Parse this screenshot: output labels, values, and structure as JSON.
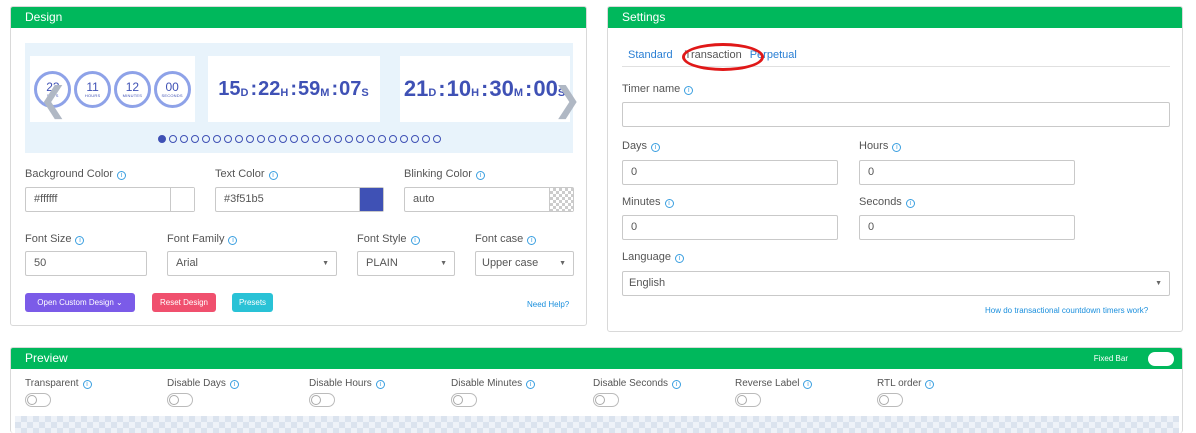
{
  "design": {
    "title": "Design",
    "circles": [
      {
        "value": "23",
        "label": "DAYS"
      },
      {
        "value": "11",
        "label": "HOURS"
      },
      {
        "value": "12",
        "label": "MINUTES"
      },
      {
        "value": "00",
        "label": "SECONDS"
      }
    ],
    "slide2": {
      "d": "15",
      "h": "22",
      "m": "59",
      "s": "07",
      "ud": "D",
      "uh": "H",
      "um": "M",
      "us": "S"
    },
    "slide3": {
      "d": "21",
      "h": "10",
      "m": "30",
      "s": "00",
      "ud": "D",
      "uh": "H",
      "um": "M",
      "us": "S"
    },
    "background_color": {
      "label": "Background Color",
      "value": "#ffffff",
      "swatch": "#ffffff"
    },
    "text_color": {
      "label": "Text Color",
      "value": "#3f51b5",
      "swatch": "#3f51b5"
    },
    "blinking_color": {
      "label": "Blinking Color",
      "value": "auto"
    },
    "font_size": {
      "label": "Font Size",
      "value": "50"
    },
    "font_family": {
      "label": "Font Family",
      "value": "Arial"
    },
    "font_style": {
      "label": "Font Style",
      "value": "PLAIN"
    },
    "font_case": {
      "label": "Font case",
      "value": "Upper case"
    },
    "buttons": {
      "custom_design": "Open Custom Design",
      "reset_design": "Reset Design",
      "presets": "Presets"
    },
    "need_help": "Need Help?"
  },
  "settings": {
    "title": "Settings",
    "tabs": [
      "Standard",
      "Transaction",
      "Perpetual"
    ],
    "timer_name": {
      "label": "Timer name",
      "value": ""
    },
    "days": {
      "label": "Days",
      "value": "0"
    },
    "hours": {
      "label": "Hours",
      "value": "0"
    },
    "minutes": {
      "label": "Minutes",
      "value": "0"
    },
    "seconds": {
      "label": "Seconds",
      "value": "0"
    },
    "language": {
      "label": "Language",
      "value": "English"
    },
    "help_link": "How do transactional countdown timers work?"
  },
  "preview": {
    "title": "Preview",
    "fixed_bar": "Fixed Bar",
    "options": [
      "Transparent",
      "Disable Days",
      "Disable Hours",
      "Disable Minutes",
      "Disable Seconds",
      "Reverse Label",
      "RTL order"
    ]
  },
  "colors": {
    "header_green": "#00b85c",
    "primary_blue": "#3f51b5",
    "btn_purple": "#7b5be8",
    "btn_red": "#f0506e",
    "btn_cyan": "#29c2d6",
    "annotation_red": "#e01818"
  },
  "icons": {
    "info": "info-icon",
    "arrow_left": "chevron-left-icon",
    "arrow_right": "chevron-right-icon",
    "select_caret": "caret-down-icon"
  }
}
